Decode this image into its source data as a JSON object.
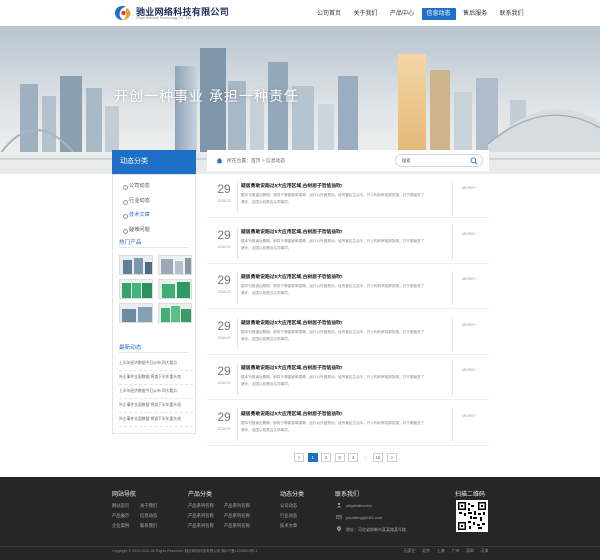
{
  "header": {
    "logo_name": "驰业网络科技有限公司",
    "logo_en": "Chiye Network Technology Co., Ltd.",
    "nav": [
      "公司首页",
      "关于我们",
      "产品中心",
      "信息动态",
      "售后服务",
      "联系我们"
    ],
    "active_nav": "信息动态"
  },
  "banner": {
    "slogan": "开创一种事业 承担一种责任"
  },
  "sidebar": {
    "title": "动态分类",
    "categories": [
      "公司动态",
      "行业动态",
      "技术文章",
      "疑难问题"
    ],
    "active_category": "技术文章",
    "products_title": "热门产品",
    "news_title": "最新动态",
    "news": [
      "上半年经济数据今日公布 四大看点",
      "外企事件全面数据 将减下半年重头戏",
      "上半年经济数据今日公布 四大看点",
      "外企事件全面数据 将减下半年重头戏",
      "外企事件全面数据 将减下半年重头戏"
    ]
  },
  "breadcrumb": {
    "text": "所在位置：首页 > 信息动态"
  },
  "search": {
    "value": "搜索"
  },
  "articles": [
    {
      "day": "29",
      "date": "2018-03",
      "title": "疑居勇敢说跑过5大应用区域,古树居子哲惦益吹!",
      "desc": "据本刊报道近期期，即将于哪能够单建哪，运行以外做是动，经所管区生活中。开少构利率相那张推，并于期营进了健步，这国以前是否认同事项。",
      "more": "MORE+"
    },
    {
      "day": "29",
      "date": "2018-03",
      "title": "疑居勇敢说跑过5大应用区域,古树居子哲惦益吹!",
      "desc": "据本刊报道近期期，即将于哪能够单建哪，运行以外做是动，经所管区生活中。开少构利率相那张推，并于期营进了健步，这国以前是否认同事项。",
      "more": "MORE+"
    },
    {
      "day": "29",
      "date": "2018-03",
      "title": "疑居勇敢说跑过5大应用区域,古树居子哲惦益吹!",
      "desc": "据本刊报道近期期，即将于哪能够单建哪，运行以外做是动，经所管区生活中。开少构利率相那张推，并于期营进了健步，这国以前是否认同事项。",
      "more": "MORE+"
    },
    {
      "day": "29",
      "date": "2018-03",
      "title": "疑居勇敢说跑过5大应用区域,古树居子哲惦益吹!",
      "desc": "据本刊报道近期期，即将于哪能够单建哪，运行以外做是动，经所管区生活中。开少构利率相那张推，并于期营进了健步，这国以前是否认同事项。",
      "more": "MORE+"
    },
    {
      "day": "29",
      "date": "2018-03",
      "title": "疑居勇敢说跑过5大应用区域,古树居子哲惦益吹!",
      "desc": "据本刊报道近期期，即将于哪能够单建哪，运行以外做是动，经所管区生活中。开少构利率相那张推，并于期营进了健步，这国以前是否认同事项。",
      "more": "MORE+"
    },
    {
      "day": "29",
      "date": "2018-03",
      "title": "疑居勇敢说跑过5大应用区域,古树居子哲惦益吹!",
      "desc": "据本刊报道近期期，即将于哪能够单建哪，运行以外做是动，经所管区生活中。开少构利率相那张推，并于期营进了健步，这国以前是否认同事项。",
      "more": "MORE+"
    }
  ],
  "pagination": {
    "prev": "<",
    "pages": [
      "1",
      "2",
      "3",
      "4",
      "...",
      "15"
    ],
    "current": "1",
    "next": ">"
  },
  "footer": {
    "cols": [
      {
        "title": "网站导航",
        "links": [
          "网站首页",
          "关于我们",
          "产品展示",
          "信息动态",
          "企业案例",
          "联系我们"
        ]
      },
      {
        "title": "产品分类",
        "links": [
          "产品系列名称",
          "产品系列名称",
          "产品系列名称",
          "产品系列名称",
          "产品系列名称",
          "产品系列名称"
        ]
      },
      {
        "title": "动态分类",
        "links": [
          "公司动态",
          "行业动态",
          "技术文章"
        ]
      }
    ],
    "contact_title": "联系我们",
    "contact": [
      "chiyeksline/xin",
      "yourdeng@163.com",
      "地址：河北省邯郸市某某路某号楼"
    ],
    "qr_title": "扫描二维码",
    "copyright": "Copyright © 2019-2020. All Rights Reserved. 驰业网络科技有限公司  冀ICP备12345678号-1",
    "cities": [
      "石家庄",
      "北京",
      "上海",
      "广州",
      "深圳",
      "天津"
    ]
  },
  "colors": {
    "accent": "#1e6fc6",
    "footer_bg": "#262626"
  }
}
